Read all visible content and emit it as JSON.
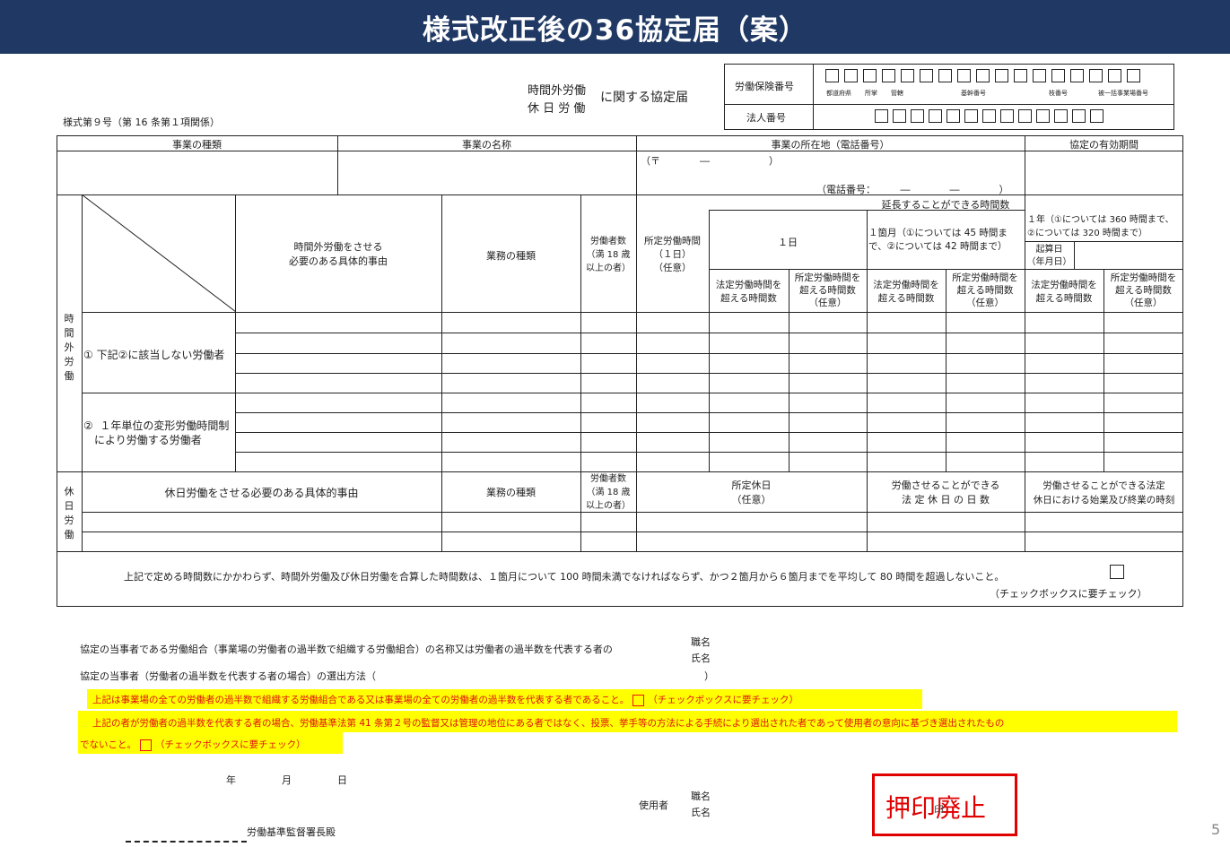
{
  "banner": {
    "title": "様式改正後の36協定届（案）"
  },
  "form": {
    "form_no": "様式第９号（第 16 条第１項関係）",
    "title_line1": "時間外労働",
    "title_line2": "休 日 労 働",
    "title_suffix": "に関する協定届",
    "insurance_label": "労働保険番号",
    "corp_label": "法人番号",
    "sub_pref": "都道府県",
    "sub_office": "所掌",
    "sub_jurisdiction": "管轄",
    "sub_base": "基幹番号",
    "sub_branch": "枝番号",
    "sub_bulk": "被一括事業場番号"
  },
  "table1": {
    "h_type": "事業の種類",
    "h_name": "事業の名称",
    "h_location": "事業の所在地（電話番号）",
    "h_period": "協定の有効期間",
    "postal": "（〒　　　　―　　　　　　）",
    "phone": "（電話番号：　　　―　　　　―　　　　）"
  },
  "overtime": {
    "side_label": "時間外労働",
    "reason": "時間外労働をさせる\n必要のある具体的事由",
    "job": "業務の種類",
    "workers": "労働者数\n（満 18 歳\n以上の者）",
    "scheduled": "所定労働時間\n（１日）\n（任意）",
    "extend": "延長することができる時間数",
    "day": "１日",
    "month": "１箇月（①については 45 時間まで、②については 42 時間まで）",
    "year": "１年（①については 360 時間まで、②については 320 時間まで）",
    "start": "起算日\n（年月日）",
    "legal": "法定労働時間を\n超える時間数",
    "sched_over": "所定労働時間を\n超える時間数\n（任意）",
    "row1": "①  下記②に該当しない労働者",
    "row2": "②  １年単位の変形労働時間制\n　により労働する労働者"
  },
  "holiday": {
    "side_label": "休日労働",
    "reason": "休日労働をさせる必要のある具体的事由",
    "job": "業務の種類",
    "workers": "労働者数\n（満 18 歳\n以上の者）",
    "scheduled": "所定休日\n（任意）",
    "days": "労働させることができる\n法 定 休 日 の 日 数",
    "times": "労働させることができる法定\n休日における始業及び終業の時刻"
  },
  "note": {
    "text": "上記で定める時間数にかかわらず、時間外労働及び休日労働を合算した時間数は、１箇月について 100 時間未満でなければならず、かつ２箇月から６箇月までを平均して 80 時間を超過しないこと。",
    "check": "（チェックボックスに要チェック）"
  },
  "party": {
    "line1": "協定の当事者である労働組合（事業場の労働者の過半数で組織する労働組合）の名称又は労働者の過半数を代表する者の",
    "line2": "協定の当事者（労働者の過半数を代表する者の場合）の選出方法（",
    "close_paren": "）",
    "title_label": "職名",
    "name_label": "氏名"
  },
  "highlight": {
    "line1": "上記は事業場の全ての労働者の過半数で組織する労働組合である又は事業場の全ての労働者の過半数を代表する者であること。",
    "line1_check": "（チェックボックスに要チェック）",
    "line2": "上記の者が労働者の過半数を代表する者の場合、労働基準法第 41 条第２号の監督又は管理の地位にある者ではなく、投票、挙手等の方法による手続により選出された者であって使用者の意向に基づき選出されたもの",
    "line3": "でないこと。",
    "line3_check": "（チェックボックスに要チェック）"
  },
  "footer": {
    "year": "年",
    "month": "月",
    "day": "日",
    "employer": "使用者",
    "title_label": "職名",
    "name_label": "氏名",
    "seal": "印",
    "office": "労働基準監督署長殿",
    "stamp": "押印廃止",
    "page": "5"
  }
}
